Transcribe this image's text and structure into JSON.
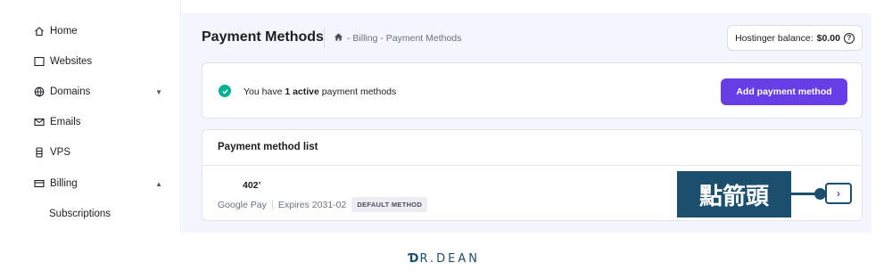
{
  "sidebar": {
    "items": [
      {
        "label": "Home",
        "icon": "home-icon"
      },
      {
        "label": "Websites",
        "icon": "browser-icon"
      },
      {
        "label": "Domains",
        "icon": "globe-icon"
      },
      {
        "label": "Emails",
        "icon": "mail-icon"
      },
      {
        "label": "VPS",
        "icon": "server-icon"
      },
      {
        "label": "Billing",
        "icon": "billing-icon"
      }
    ],
    "sub_items": [
      {
        "label": "Subscriptions"
      }
    ]
  },
  "header": {
    "title": "Payment Methods",
    "breadcrumb": "- Billing - Payment Methods",
    "balance_label": "Hostinger balance:",
    "balance_value": "$0.00"
  },
  "active_card": {
    "prefix": "You have",
    "count": "1 active",
    "suffix": "payment methods",
    "add_button": "Add payment method"
  },
  "list": {
    "title": "Payment method list",
    "card_number": "402’",
    "provider": "Google Pay",
    "expires": "Expires 2031-02",
    "badge": "DEFAULT METHOD"
  },
  "annotation": {
    "label": "點箭頭"
  },
  "logo": {
    "text": "R.DEAN"
  },
  "colors": {
    "accent": "#673de6",
    "success": "#00b090",
    "annotation": "#1c4e6e"
  }
}
